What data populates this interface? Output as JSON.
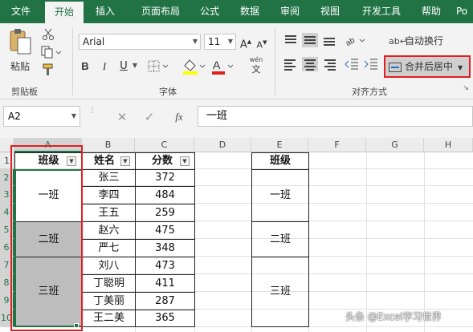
{
  "menu": {
    "tabs": [
      "文件",
      "开始",
      "插入",
      "页面布局",
      "公式",
      "数据",
      "审阅",
      "视图",
      "开发工具",
      "帮助",
      "Po"
    ]
  },
  "ribbon": {
    "clipboard": {
      "paste_label": "粘贴",
      "group_label": "剪贴板"
    },
    "font": {
      "font_name": "Arial",
      "font_size": "11",
      "bold": "B",
      "italic": "I",
      "underline": "U",
      "group_label": "字体",
      "wen_label": "wén",
      "wen_char": "文",
      "grow": "A",
      "shrink": "A"
    },
    "alignment": {
      "wrap_label": "自动换行",
      "merge_label": "合并后居中",
      "group_label": "对齐方式"
    }
  },
  "formula_bar": {
    "name_box": "A2",
    "fx": "fx",
    "content": "一班"
  },
  "sheet": {
    "columns": [
      "A",
      "B",
      "C",
      "D",
      "E",
      "F",
      "G",
      "H"
    ],
    "rows": [
      "1",
      "2",
      "3",
      "4",
      "5",
      "6",
      "7",
      "8",
      "9",
      "10"
    ],
    "headers": {
      "a1": "班级",
      "b1": "姓名",
      "c1": "分数",
      "e1": "班级"
    },
    "names": [
      "张三",
      "李四",
      "王五",
      "赵六",
      "严七",
      "刘八",
      "丁聪明",
      "丁美丽",
      "王二美"
    ],
    "scores": [
      "372",
      "484",
      "259",
      "475",
      "348",
      "473",
      "411",
      "287",
      "365"
    ],
    "classes": [
      "一班",
      "二班",
      "三班"
    ]
  },
  "watermark": "头条 @Excel学习世界",
  "colors": {
    "menu_bg": "#217346",
    "selection": "#217346",
    "highlight_box": "#e02020",
    "merged_fill": "#bdbdbd"
  }
}
